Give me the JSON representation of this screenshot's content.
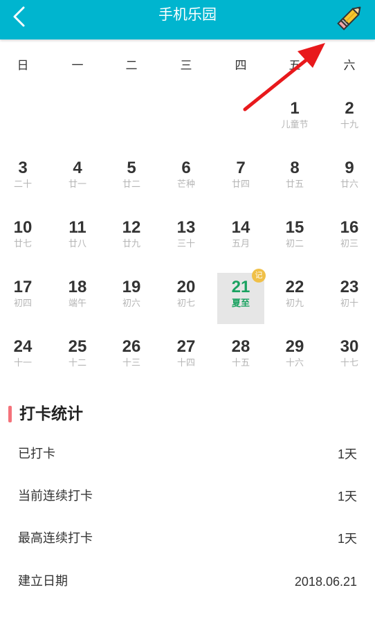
{
  "header": {
    "title": "手机乐园",
    "back_icon": "chevron-left-icon",
    "edit_icon": "pencil-icon"
  },
  "weekdays": [
    "日",
    "一",
    "二",
    "三",
    "四",
    "五",
    "六"
  ],
  "calendar": {
    "weeks": [
      [
        null,
        null,
        null,
        null,
        null,
        {
          "day": "1",
          "sub": "儿童节"
        },
        {
          "day": "2",
          "sub": "十九"
        }
      ],
      [
        {
          "day": "3",
          "sub": "二十"
        },
        {
          "day": "4",
          "sub": "廿一"
        },
        {
          "day": "5",
          "sub": "廿二"
        },
        {
          "day": "6",
          "sub": "芒种"
        },
        {
          "day": "7",
          "sub": "廿四"
        },
        {
          "day": "8",
          "sub": "廿五"
        },
        {
          "day": "9",
          "sub": "廿六"
        }
      ],
      [
        {
          "day": "10",
          "sub": "廿七"
        },
        {
          "day": "11",
          "sub": "廿八"
        },
        {
          "day": "12",
          "sub": "廿九"
        },
        {
          "day": "13",
          "sub": "三十"
        },
        {
          "day": "14",
          "sub": "五月"
        },
        {
          "day": "15",
          "sub": "初二"
        },
        {
          "day": "16",
          "sub": "初三"
        }
      ],
      [
        {
          "day": "17",
          "sub": "初四"
        },
        {
          "day": "18",
          "sub": "端午"
        },
        {
          "day": "19",
          "sub": "初六"
        },
        {
          "day": "20",
          "sub": "初七"
        },
        {
          "day": "21",
          "sub": "夏至",
          "selected": true,
          "badge": "记"
        },
        {
          "day": "22",
          "sub": "初九"
        },
        {
          "day": "23",
          "sub": "初十"
        }
      ],
      [
        {
          "day": "24",
          "sub": "十一"
        },
        {
          "day": "25",
          "sub": "十二"
        },
        {
          "day": "26",
          "sub": "十三"
        },
        {
          "day": "27",
          "sub": "十四"
        },
        {
          "day": "28",
          "sub": "十五"
        },
        {
          "day": "29",
          "sub": "十六"
        },
        {
          "day": "30",
          "sub": "十七"
        }
      ]
    ]
  },
  "stats": {
    "title": "打卡统计",
    "rows": [
      {
        "label": "已打卡",
        "value": "1天"
      },
      {
        "label": "当前连续打卡",
        "value": "1天"
      },
      {
        "label": "最高连续打卡",
        "value": "1天"
      },
      {
        "label": "建立日期",
        "value": "2018.06.21"
      }
    ]
  },
  "colors": {
    "header_bg": "#00b5cf",
    "selected_text": "#1aa260",
    "badge": "#f0c048",
    "accent_bar": "#f4727a",
    "arrow": "#e8191c"
  }
}
